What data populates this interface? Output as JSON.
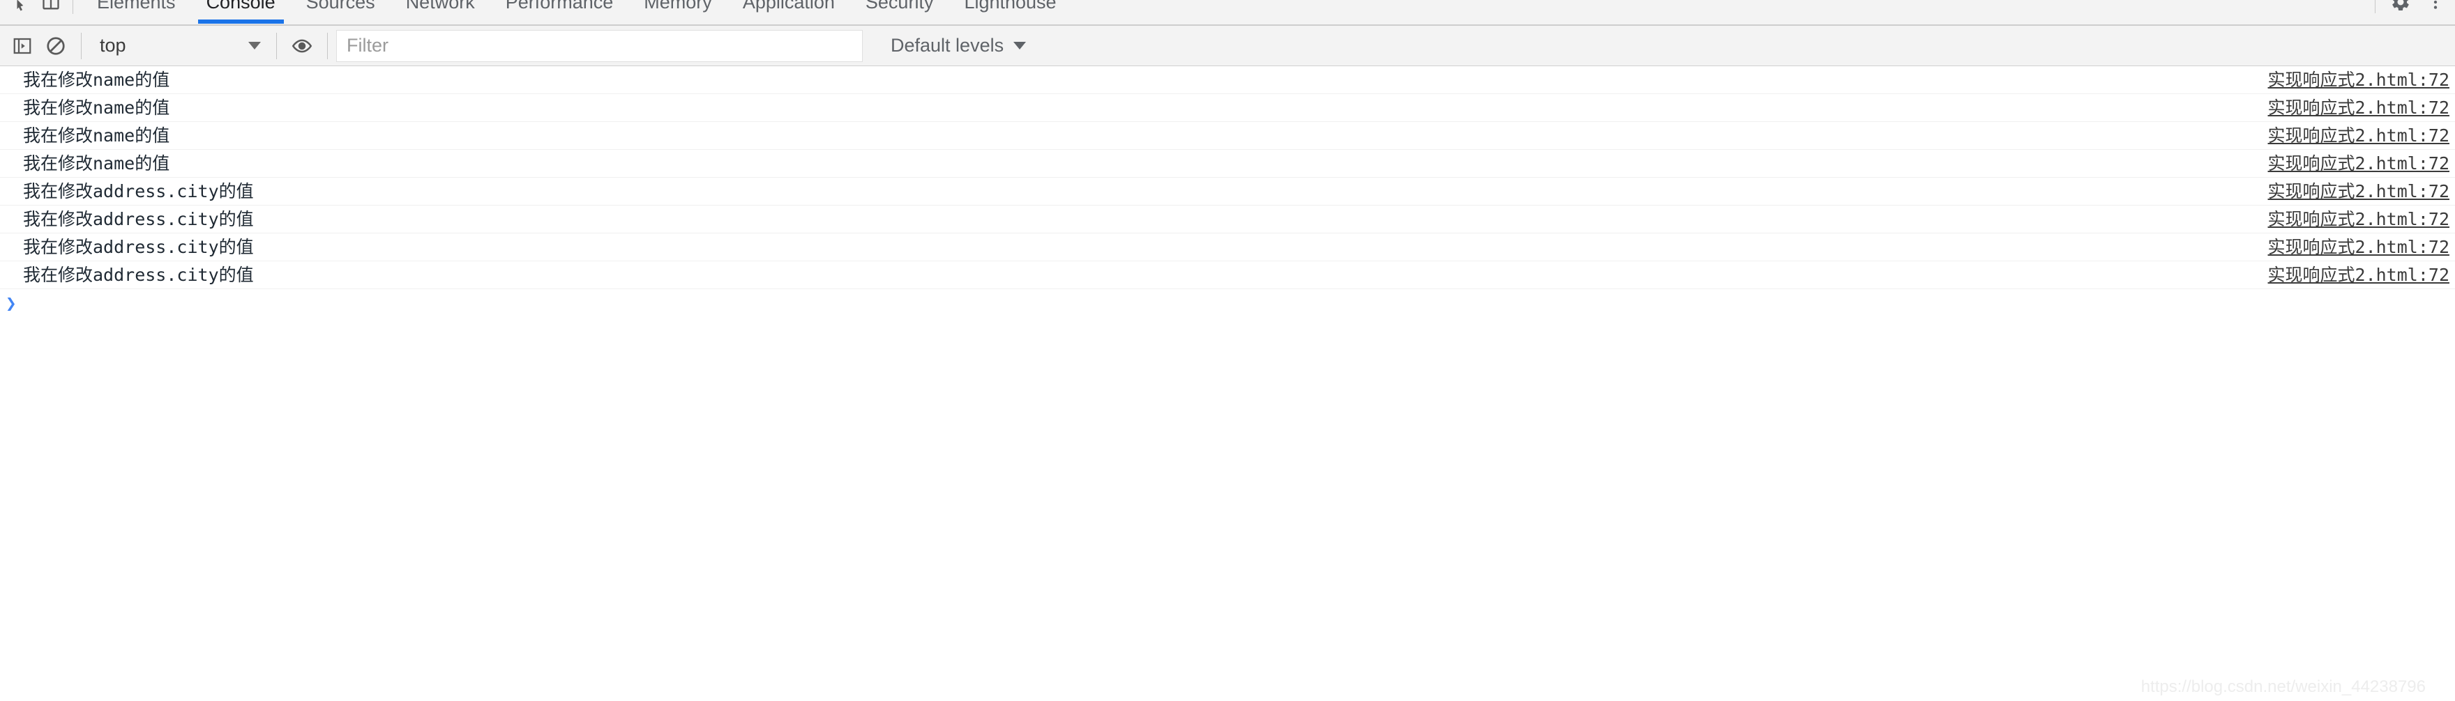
{
  "devtools": {
    "tabs": [
      {
        "label": "Elements",
        "active": false
      },
      {
        "label": "Console",
        "active": true
      },
      {
        "label": "Sources",
        "active": false
      },
      {
        "label": "Network",
        "active": false
      },
      {
        "label": "Performance",
        "active": false
      },
      {
        "label": "Memory",
        "active": false
      },
      {
        "label": "Application",
        "active": false
      },
      {
        "label": "Security",
        "active": false
      },
      {
        "label": "Lighthouse",
        "active": false
      }
    ],
    "left_icons": [
      {
        "name": "inspect-element-icon"
      },
      {
        "name": "device-toolbar-icon"
      }
    ],
    "right_icons": [
      {
        "name": "settings-gear-icon"
      },
      {
        "name": "more-options-icon"
      }
    ]
  },
  "toolbar": {
    "sidebar_toggle_icon": "console-sidebar-icon",
    "clear_console_icon": "clear-console-icon",
    "context_selector": {
      "value": "top",
      "options": [
        "top"
      ]
    },
    "live_expression_icon": "eye-icon",
    "filter": {
      "value": "",
      "placeholder": "Filter"
    },
    "log_levels": {
      "value": "Default levels"
    }
  },
  "console": {
    "messages": [
      {
        "text": "我在修改name的值",
        "source": "实现响应式2.html:72"
      },
      {
        "text": "我在修改name的值",
        "source": "实现响应式2.html:72"
      },
      {
        "text": "我在修改name的值",
        "source": "实现响应式2.html:72"
      },
      {
        "text": "我在修改name的值",
        "source": "实现响应式2.html:72"
      },
      {
        "text": "我在修改address.city的值",
        "source": "实现响应式2.html:72"
      },
      {
        "text": "我在修改address.city的值",
        "source": "实现响应式2.html:72"
      },
      {
        "text": "我在修改address.city的值",
        "source": "实现响应式2.html:72"
      },
      {
        "text": "我在修改address.city的值",
        "source": "实现响应式2.html:72"
      }
    ],
    "prompt_caret": "❯",
    "prompt_value": ""
  },
  "watermark": {
    "text": "https://blog.csdn.net/weixin_44238796"
  },
  "colors": {
    "accent": "#1a73e8",
    "toolbar_bg": "#f3f3f3",
    "prompt_blue": "#4285f4",
    "message_text": "#1f2933",
    "watermark": "#ededed"
  }
}
